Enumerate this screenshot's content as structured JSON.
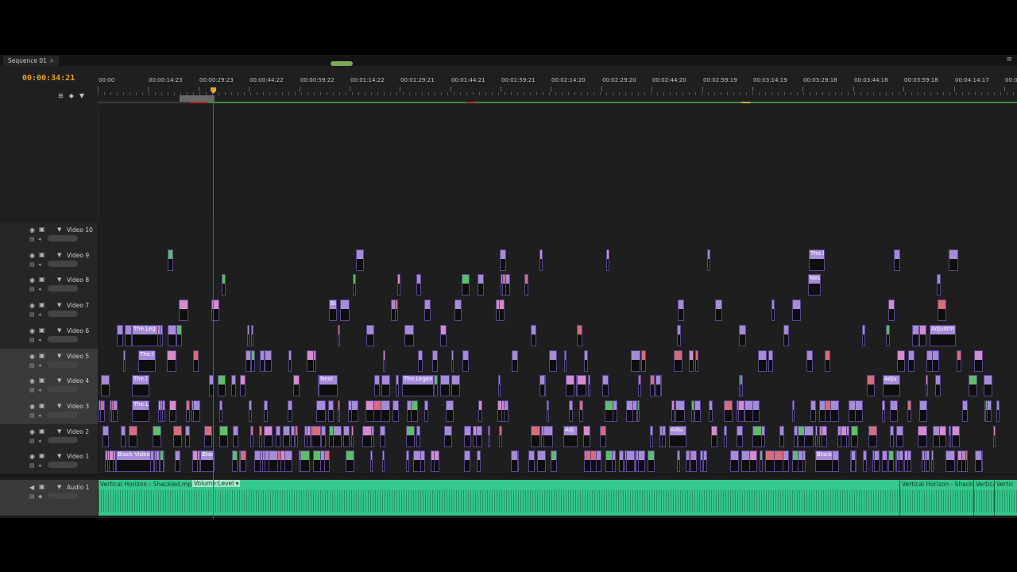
{
  "tab": {
    "title": "Sequence 01",
    "close": "×"
  },
  "panel_menu": "≡",
  "timecode": "00:00:34:21",
  "header_tools": [
    "⊞",
    "◆",
    "▼"
  ],
  "ruler_ticks": [
    "00:00",
    "00:00:14:23",
    "00:00:29:23",
    "00:00:44:22",
    "00:00:59:22",
    "00:01:14:22",
    "00:01:29:21",
    "00:01:44:21",
    "00:01:59:21",
    "00:02:14:20",
    "00:02:29:20",
    "00:02:44:20",
    "00:02:59:19",
    "00:03:14:19",
    "00:03:29:18",
    "00:03:44:18",
    "00:03:59:18",
    "00:04:14:17",
    "00:04:29:17"
  ],
  "playhead": {
    "position": "00:00:34:21",
    "color": "#c0392b"
  },
  "colors": {
    "accent": "#e8a21c",
    "video_clip": "#a68bd9",
    "audio_clip": "#35c78c",
    "playhead": "#c0392b"
  },
  "tracks": {
    "video": [
      {
        "name": "Video 10"
      },
      {
        "name": "Video 9"
      },
      {
        "name": "Video 8"
      },
      {
        "name": "Video 7"
      },
      {
        "name": "Video 6"
      },
      {
        "name": "Video 5"
      },
      {
        "name": "Video 4"
      },
      {
        "name": "Video 3"
      },
      {
        "name": "Video 2"
      },
      {
        "name": "Video 1"
      }
    ],
    "audio": [
      {
        "name": "Audio 1"
      }
    ]
  },
  "clip_labels": {
    "v6_legend": "The.Leg",
    "v6_adjust": "Adjustm",
    "v5_the": "The.l",
    "v4_the": "The.l",
    "v4_legend": "The.Legen",
    "v4_nest": "Nest",
    "v4_adju": "Adju",
    "v3_the": "The.Li",
    "v2_adj": "Adj",
    "v2_adju": "Adju",
    "v1_black_video": "Black Video",
    "v1_black": "Black",
    "v1_black2": "Black",
    "v9_the": "The.l",
    "v8_nes": "Nes",
    "v7_bl": "Bl"
  },
  "audio": {
    "clip1": "Vertical Horizon - Shackled.mp3",
    "volume_label": "Volume:Level ▾",
    "clip2": "Vertical Horizon - Shackle",
    "clip3": "Vertica",
    "clip4": "Vertic"
  }
}
